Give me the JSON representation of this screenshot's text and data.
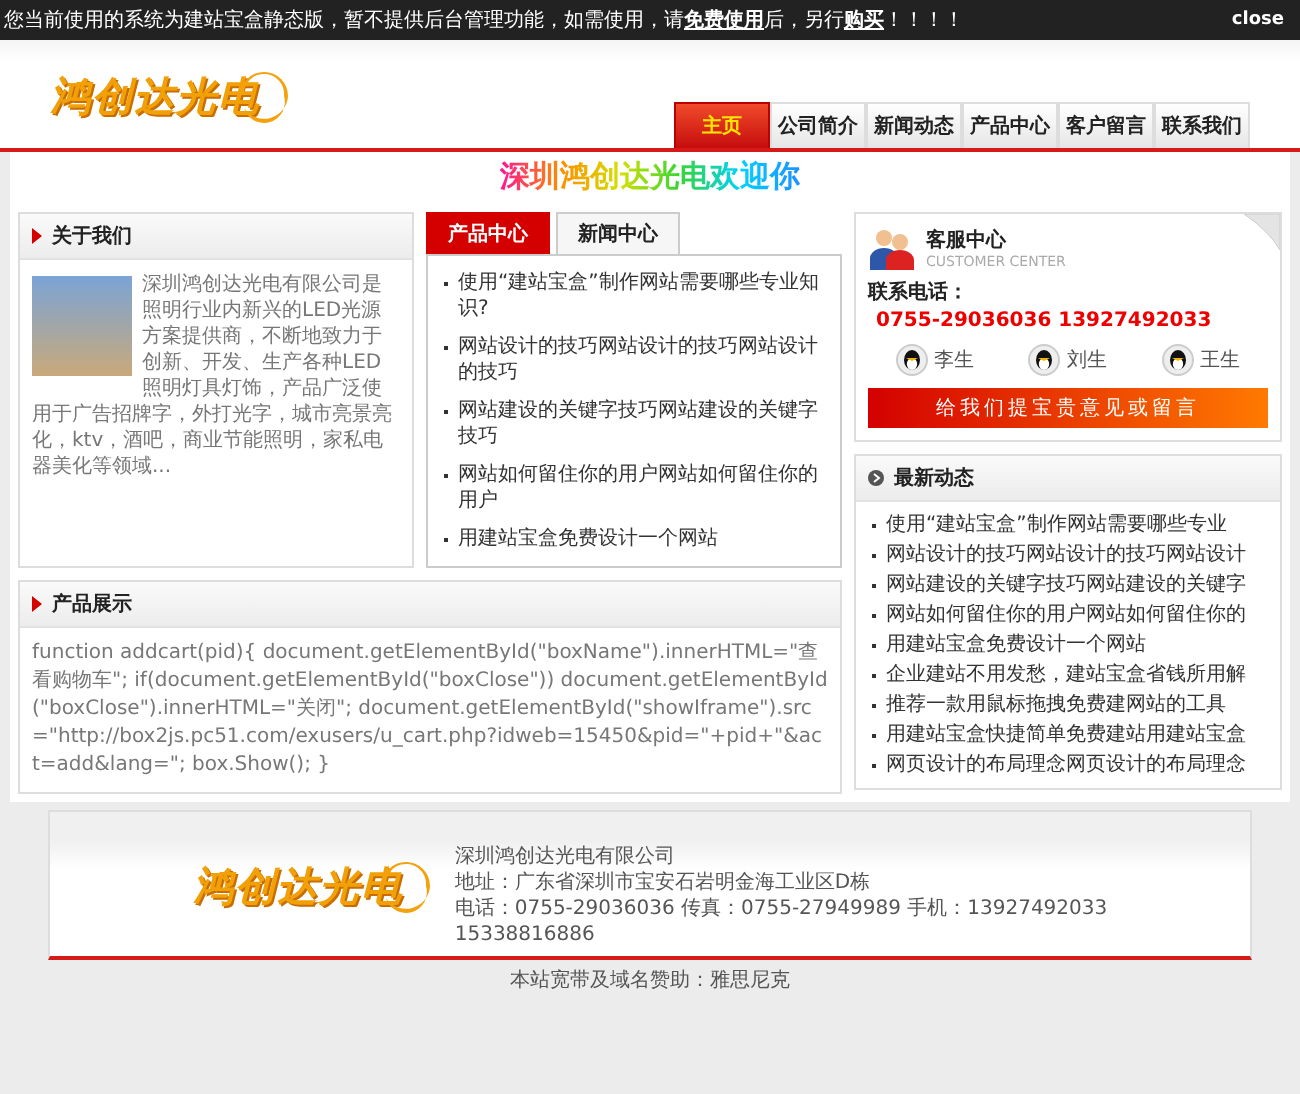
{
  "notice": {
    "parts": [
      {
        "kind": "text",
        "text": "您当前使用的系统为建站宝盒静态版，暂不提供后台管理功能，如需使用，请"
      },
      {
        "kind": "link",
        "text": "免费使用"
      },
      {
        "kind": "text",
        "text": "后，另行"
      },
      {
        "kind": "link",
        "text": "购买"
      },
      {
        "kind": "text",
        "text": "！！！！"
      }
    ],
    "close": "close"
  },
  "header": {
    "logo": "鸿创达光电",
    "nav": [
      {
        "label": "主页",
        "selected": true
      },
      {
        "label": "公司简介",
        "selected": false
      },
      {
        "label": "新闻动态",
        "selected": false
      },
      {
        "label": "产品中心",
        "selected": false
      },
      {
        "label": "客户留言",
        "selected": false
      },
      {
        "label": "联系我们",
        "selected": false
      }
    ]
  },
  "welcome": "深圳鸿创达光电欢迎你",
  "about": {
    "title": "关于我们",
    "text": "深圳鸿创达光电有限公司是照明行业内新兴的LED光源方案提供商，不断地致力于创新、开发、生产各种LED照明灯具灯饰，产品广泛使用于广告招牌字，外打光字，城市亮景亮化，ktv，酒吧，商业节能照明，家私电器美化等领域..."
  },
  "news_tabs": {
    "tabs": [
      {
        "label": "产品中心",
        "selected": true
      },
      {
        "label": "新闻中心",
        "selected": false
      }
    ],
    "items": [
      "使用“建站宝盒”制作网站需要哪些专业知识?",
      "网站设计的技巧网站设计的技巧网站设计的技巧",
      "网站建设的关键字技巧网站建设的关键字技巧",
      "网站如何留住你的用户网站如何留住你的用户",
      "用建站宝盒免费设计一个网站"
    ]
  },
  "products": {
    "title": "产品展示",
    "code": "function addcart(pid){ document.getElementById(\"boxName\").innerHTML=\"查看购物车\"; if(document.getElementById(\"boxClose\")) document.getElementById(\"boxClose\").innerHTML=\"关闭\"; document.getElementById(\"showIframe\").src=\"http://box2js.pc51.com/exusers/u_cart.php?idweb=15450&pid=\"+pid+\"&act=add&lang=\"; box.Show(); }"
  },
  "service": {
    "title": "客服中心",
    "subtitle": "CUSTOMER CENTER",
    "phone_label": "联系电话：",
    "phone": "0755-29036036 13927492033",
    "contacts": [
      "李生",
      "刘生",
      "王生"
    ],
    "message_button": "给我们提宝贵意见或留言"
  },
  "latest": {
    "title": "最新动态",
    "items": [
      "使用“建站宝盒”制作网站需要哪些专业",
      "网站设计的技巧网站设计的技巧网站设计",
      "网站建设的关键字技巧网站建设的关键字",
      "网站如何留住你的用户网站如何留住你的",
      "用建站宝盒免费设计一个网站",
      "企业建站不用发愁，建站宝盒省钱所用解",
      "推荐一款用鼠标拖拽免费建网站的工具",
      "用建站宝盒快捷简单免费建站用建站宝盒",
      "网页设计的布局理念网页设计的布局理念"
    ]
  },
  "footer": {
    "logo": "鸿创达光电",
    "lines": [
      "深圳鸿创达光电有限公司",
      "地址：广东省深圳市宝安石岩明金海工业区D栋",
      "电话：0755-29036036 传真：0755-27949989 手机：13927492033",
      "15338816886"
    ],
    "credit": "本站宽带及域名赞助：雅思尼克"
  }
}
